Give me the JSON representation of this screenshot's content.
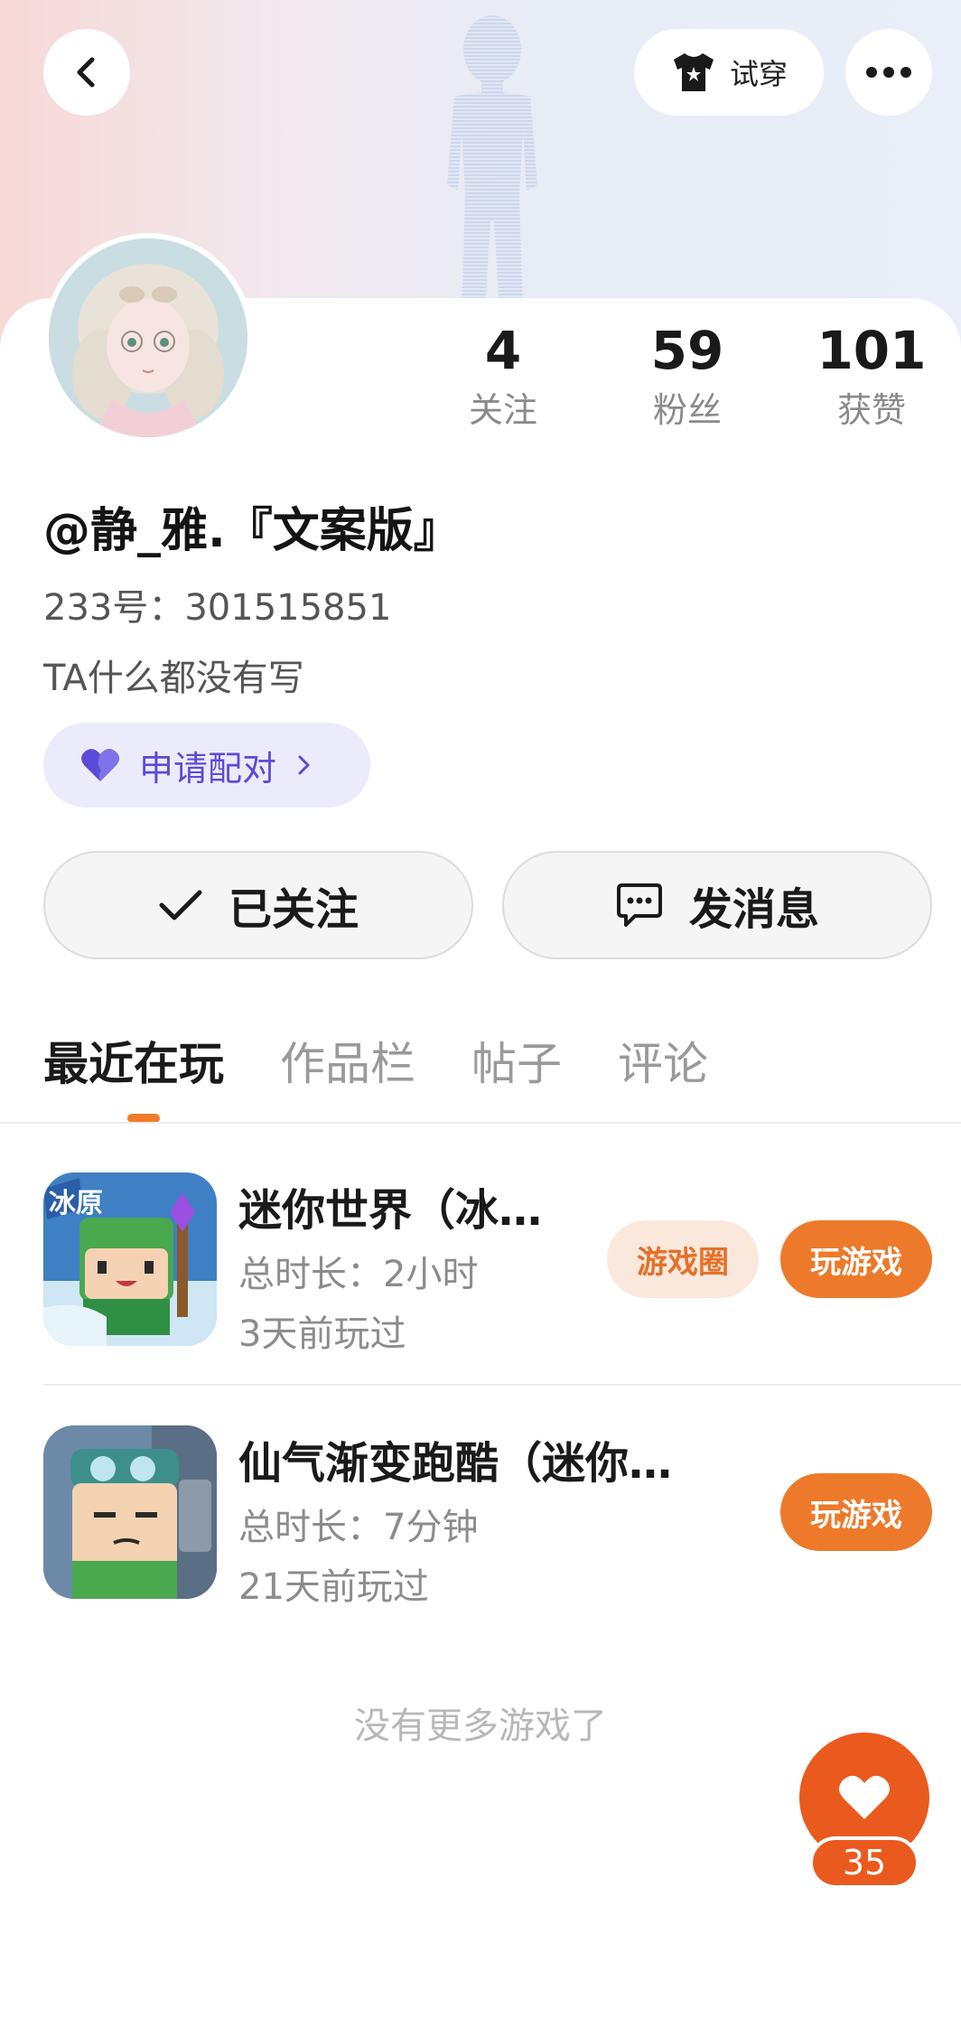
{
  "header": {
    "tryon_label": "试穿"
  },
  "profile": {
    "username": "@静_雅.『文案版』",
    "id_label": "233号：301515851",
    "bio": "TA什么都没有写",
    "pair_label": "申请配对"
  },
  "stats": [
    {
      "value": "4",
      "label": "关注"
    },
    {
      "value": "59",
      "label": "粉丝"
    },
    {
      "value": "101",
      "label": "获赞"
    }
  ],
  "actions": {
    "follow_label": "已关注",
    "message_label": "发消息"
  },
  "tabs": [
    {
      "label": "最近在玩",
      "active": true
    },
    {
      "label": "作品栏",
      "active": false
    },
    {
      "label": "帖子",
      "active": false
    },
    {
      "label": "评论",
      "active": false
    }
  ],
  "games": [
    {
      "title": "迷你世界（冰…",
      "duration": "总时长：2小时",
      "last_played": "3天前玩过",
      "circle_label": "游戏圈",
      "play_label": "玩游戏",
      "icon_badge": "冰原"
    },
    {
      "title": "仙气渐变跑酷（迷你…",
      "duration": "总时长：7分钟",
      "last_played": "21天前玩过",
      "play_label": "玩游戏"
    }
  ],
  "footer": {
    "no_more": "没有更多游戏了"
  },
  "like": {
    "count": "35"
  },
  "colors": {
    "accent_orange": "#ec7a2a",
    "like_orange": "#ea5a1e",
    "pair_purple": "#5a4cd6",
    "pair_bg": "#ecebfb"
  }
}
